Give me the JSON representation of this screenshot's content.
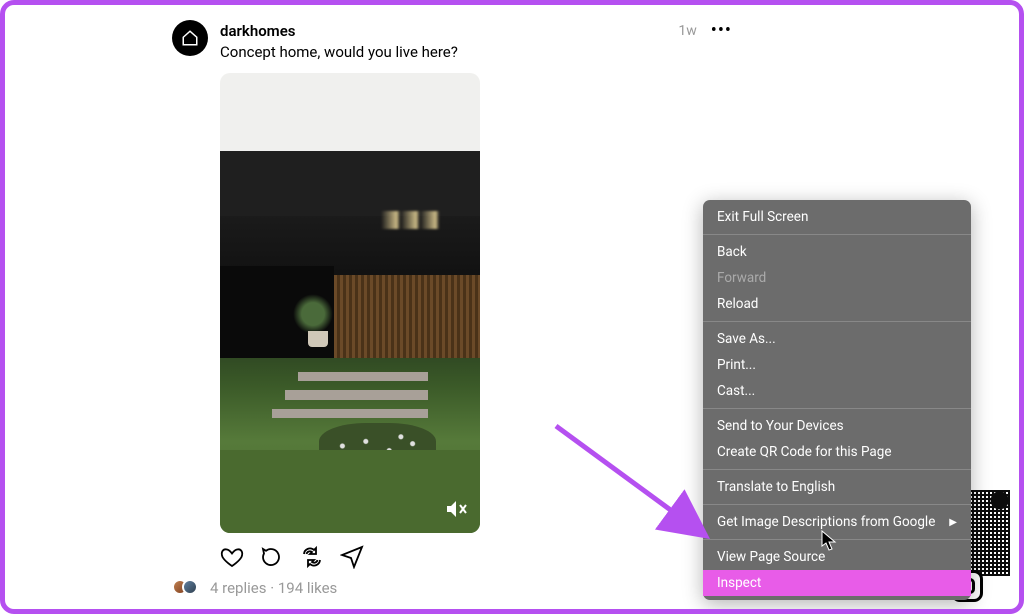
{
  "post": {
    "username": "darkhomes",
    "avatar_icon": "home-outline-icon",
    "timestamp": "1w",
    "caption": "Concept home, would you live here?",
    "replies_label": "4 replies",
    "likes_label": "194 likes",
    "separator": " · "
  },
  "context_menu": {
    "items": [
      {
        "label": "Exit Full Screen",
        "enabled": true
      },
      {
        "sep": true
      },
      {
        "label": "Back",
        "enabled": true
      },
      {
        "label": "Forward",
        "enabled": false
      },
      {
        "label": "Reload",
        "enabled": true
      },
      {
        "sep": true
      },
      {
        "label": "Save As...",
        "enabled": true
      },
      {
        "label": "Print...",
        "enabled": true
      },
      {
        "label": "Cast...",
        "enabled": true
      },
      {
        "sep": true
      },
      {
        "label": "Send to Your Devices",
        "enabled": true
      },
      {
        "label": "Create QR Code for this Page",
        "enabled": true
      },
      {
        "sep": true
      },
      {
        "label": "Translate to English",
        "enabled": true
      },
      {
        "sep": true
      },
      {
        "label": "Get Image Descriptions from Google",
        "enabled": true,
        "submenu": true
      },
      {
        "sep": true
      },
      {
        "label": "View Page Source",
        "enabled": true
      },
      {
        "label": "Inspect",
        "enabled": true,
        "highlighted": true
      }
    ]
  },
  "annotation": {
    "arrow_color": "#b550f0"
  }
}
